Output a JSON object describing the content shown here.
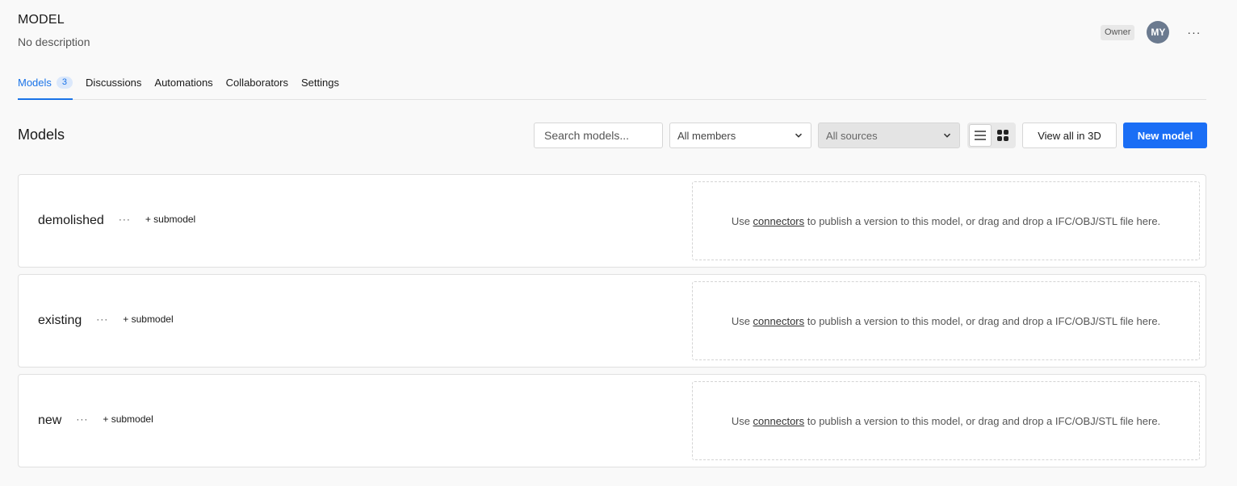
{
  "project": {
    "title": "MODEL",
    "description": "No description",
    "role": "Owner",
    "avatar_initials": "MY"
  },
  "tabs": [
    {
      "label": "Models",
      "count": "3",
      "active": true
    },
    {
      "label": "Discussions"
    },
    {
      "label": "Automations"
    },
    {
      "label": "Collaborators"
    },
    {
      "label": "Settings"
    }
  ],
  "section": {
    "title": "Models"
  },
  "toolbar": {
    "search_placeholder": "Search models...",
    "members_filter": "All members",
    "sources_filter": "All sources",
    "view_all_label": "View all in 3D",
    "new_model_label": "New model"
  },
  "dropzone": {
    "prefix": "Use ",
    "link": "connectors",
    "suffix": " to publish a version to this model, or drag and drop a IFC/OBJ/STL file here."
  },
  "models": [
    {
      "name": "demolished",
      "submodel_label": "+ submodel"
    },
    {
      "name": "existing",
      "submodel_label": "+ submodel"
    },
    {
      "name": "new",
      "submodel_label": "+ submodel"
    }
  ],
  "colors": {
    "accent": "#1a6ef5",
    "tab_active": "#1a73e8"
  }
}
